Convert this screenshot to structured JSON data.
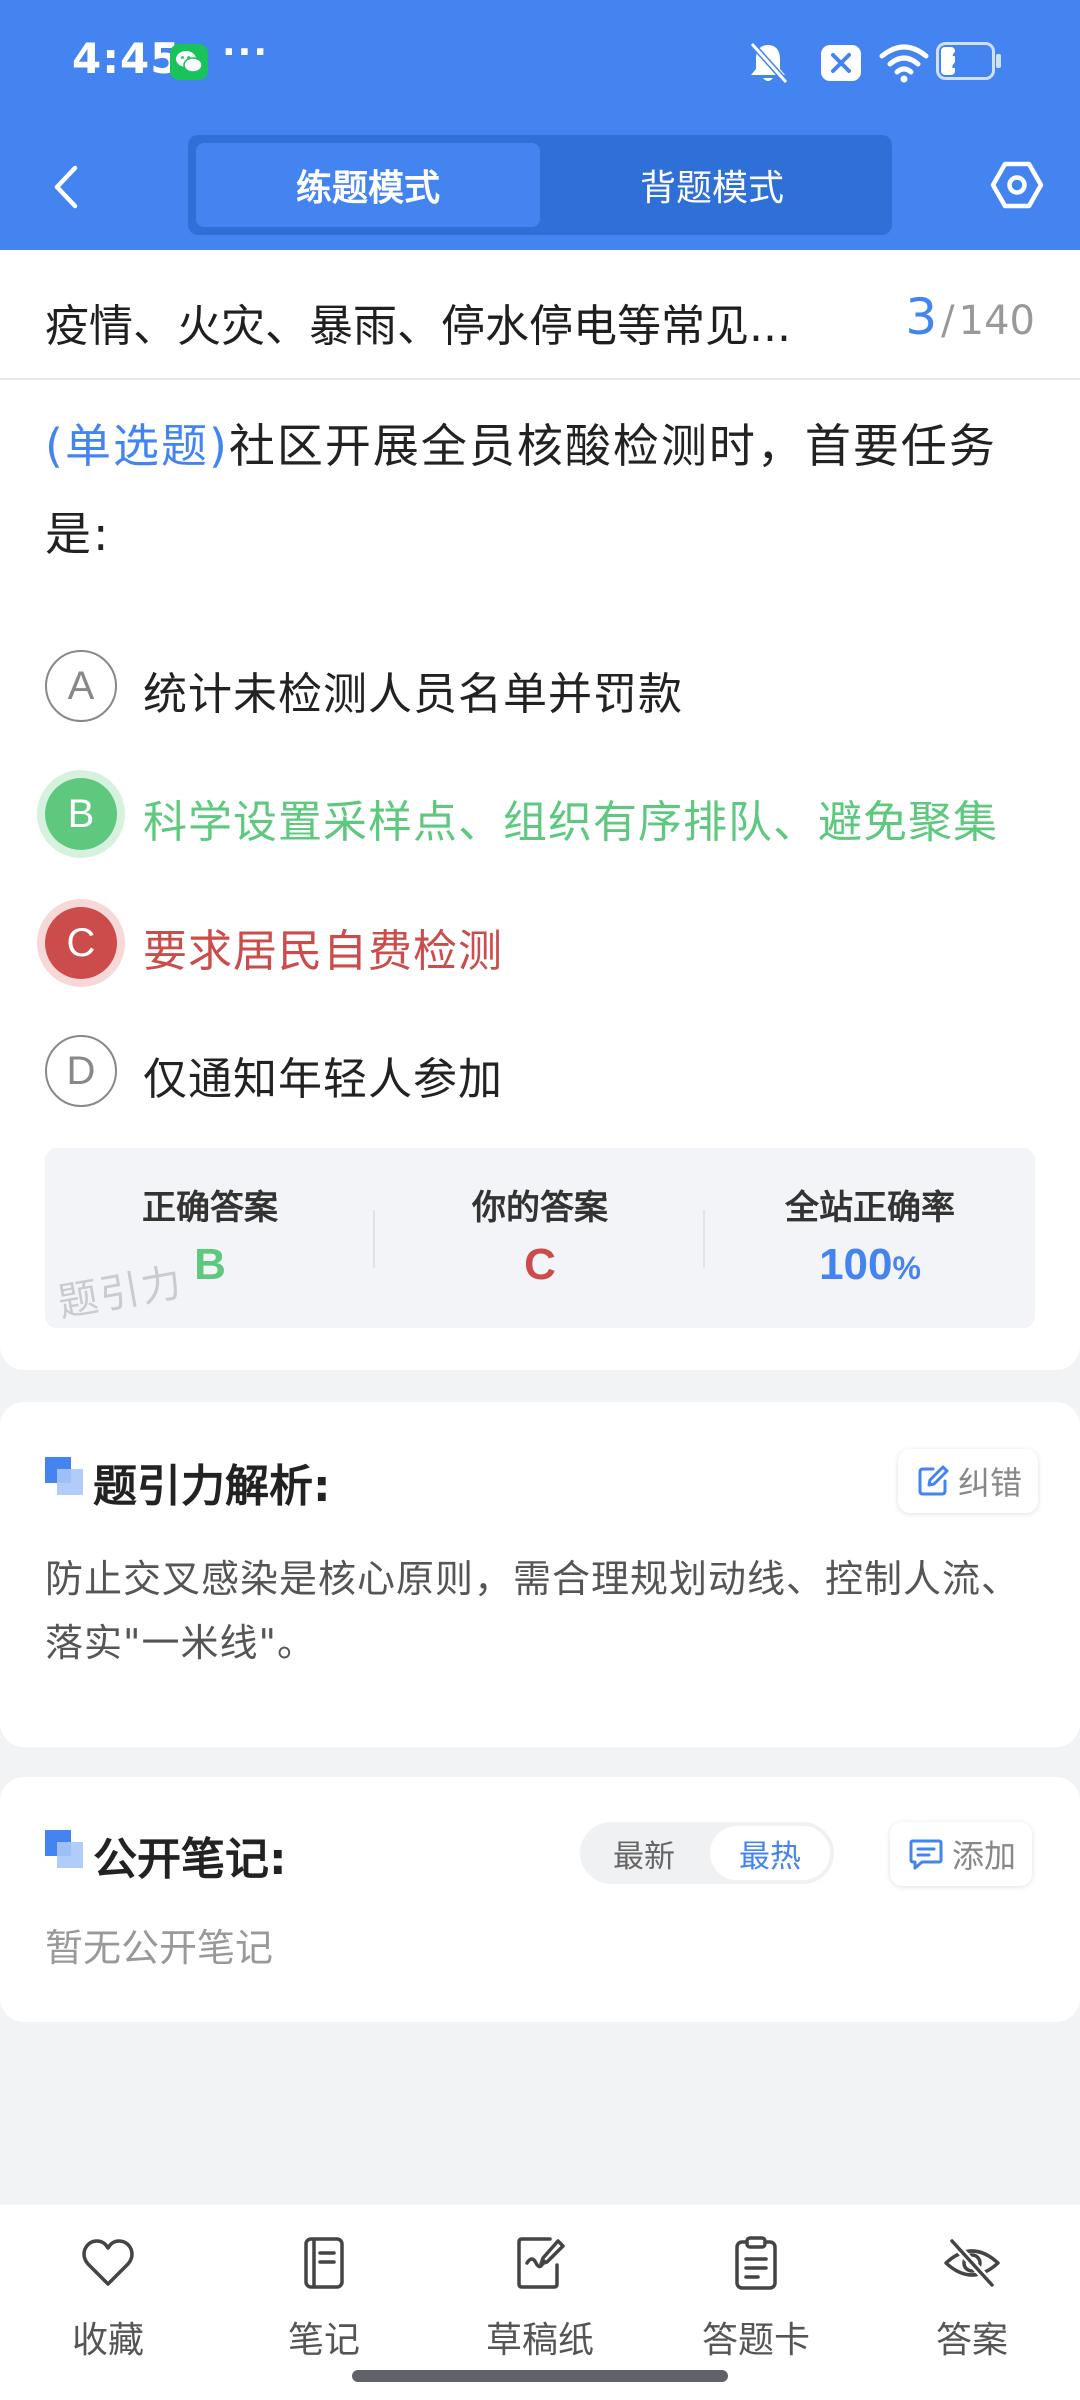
{
  "status_bar": {
    "time": "4:45",
    "more": "···",
    "battery": "21",
    "icons": [
      "wechat-icon",
      "bell-off-icon",
      "close-badge-icon",
      "wifi-icon",
      "battery-icon"
    ]
  },
  "nav": {
    "back_icon": "back-arrow-icon",
    "tabs": [
      {
        "label": "练题模式",
        "active": true
      },
      {
        "label": "背题模式",
        "active": false
      }
    ],
    "settings_icon": "settings-hexagon-icon"
  },
  "question": {
    "chapter_title": "疫情、火灾、暴雨、停水停电等常见...",
    "current": "3",
    "separator": "/",
    "total": "140",
    "type_label": "(单选题)",
    "stem": "社区开展全员核酸检测时，首要任务是:",
    "options": [
      {
        "letter": "A",
        "text": "统计未检测人员名单并罚款",
        "state": "normal"
      },
      {
        "letter": "B",
        "text": "科学设置采样点、组织有序排队、避免聚集",
        "state": "correct"
      },
      {
        "letter": "C",
        "text": "要求居民自费检测",
        "state": "wrong"
      },
      {
        "letter": "D",
        "text": "仅通知年轻人参加",
        "state": "normal"
      }
    ]
  },
  "result": {
    "correct_label": "正确答案",
    "correct_value": "B",
    "yours_label": "你的答案",
    "yours_value": "C",
    "rate_label": "全站正确率",
    "rate_value": "100",
    "rate_unit": "%",
    "watermark": "题引力"
  },
  "analysis": {
    "title": "题引力解析:",
    "report_button": "纠错",
    "text": "防止交叉感染是核心原则，需合理规划动线、控制人流、落实\"一米线\"。"
  },
  "notes": {
    "title": "公开笔记:",
    "sort_latest": "最新",
    "sort_hot": "最热",
    "add_button": "添加",
    "empty_text": "暂无公开笔记"
  },
  "bottom_tabs": [
    {
      "label": "收藏",
      "icon": "heart-icon"
    },
    {
      "label": "笔记",
      "icon": "notebook-icon"
    },
    {
      "label": "草稿纸",
      "icon": "draft-paper-icon"
    },
    {
      "label": "答题卡",
      "icon": "answer-card-icon"
    },
    {
      "label": "答案",
      "icon": "eye-off-icon"
    }
  ],
  "colors": {
    "primary": "#4384f0",
    "correct": "#5ec97e",
    "wrong": "#cc4b4b"
  }
}
